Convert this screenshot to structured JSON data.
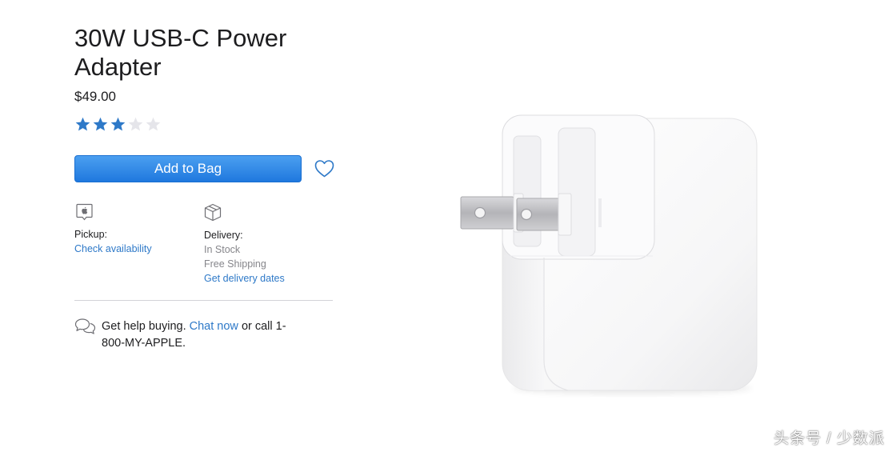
{
  "product": {
    "title": "30W USB-C Power Adapter",
    "price": "$49.00",
    "rating": {
      "filled": 3,
      "total": 5
    },
    "image_icon": "power-adapter-image"
  },
  "actions": {
    "add_to_bag_label": "Add to Bag",
    "favorite_icon": "heart-icon"
  },
  "pickup": {
    "icon": "apple-store-icon",
    "label": "Pickup:",
    "link": "Check availability"
  },
  "delivery": {
    "icon": "box-icon",
    "label": "Delivery:",
    "status": "In Stock",
    "shipping": "Free Shipping",
    "link": "Get delivery dates"
  },
  "help": {
    "icon": "chat-bubbles-icon",
    "prefix": "Get help buying.",
    "chat_link": "Chat now",
    "middle": "or call",
    "phone": "1-800-MY-APPLE."
  },
  "colors": {
    "accent": "#2e79c8",
    "button": "#1f78de",
    "star_filled": "#2e79c8",
    "star_empty": "#e5e5ea"
  },
  "watermark": "头条号 / 少数派"
}
